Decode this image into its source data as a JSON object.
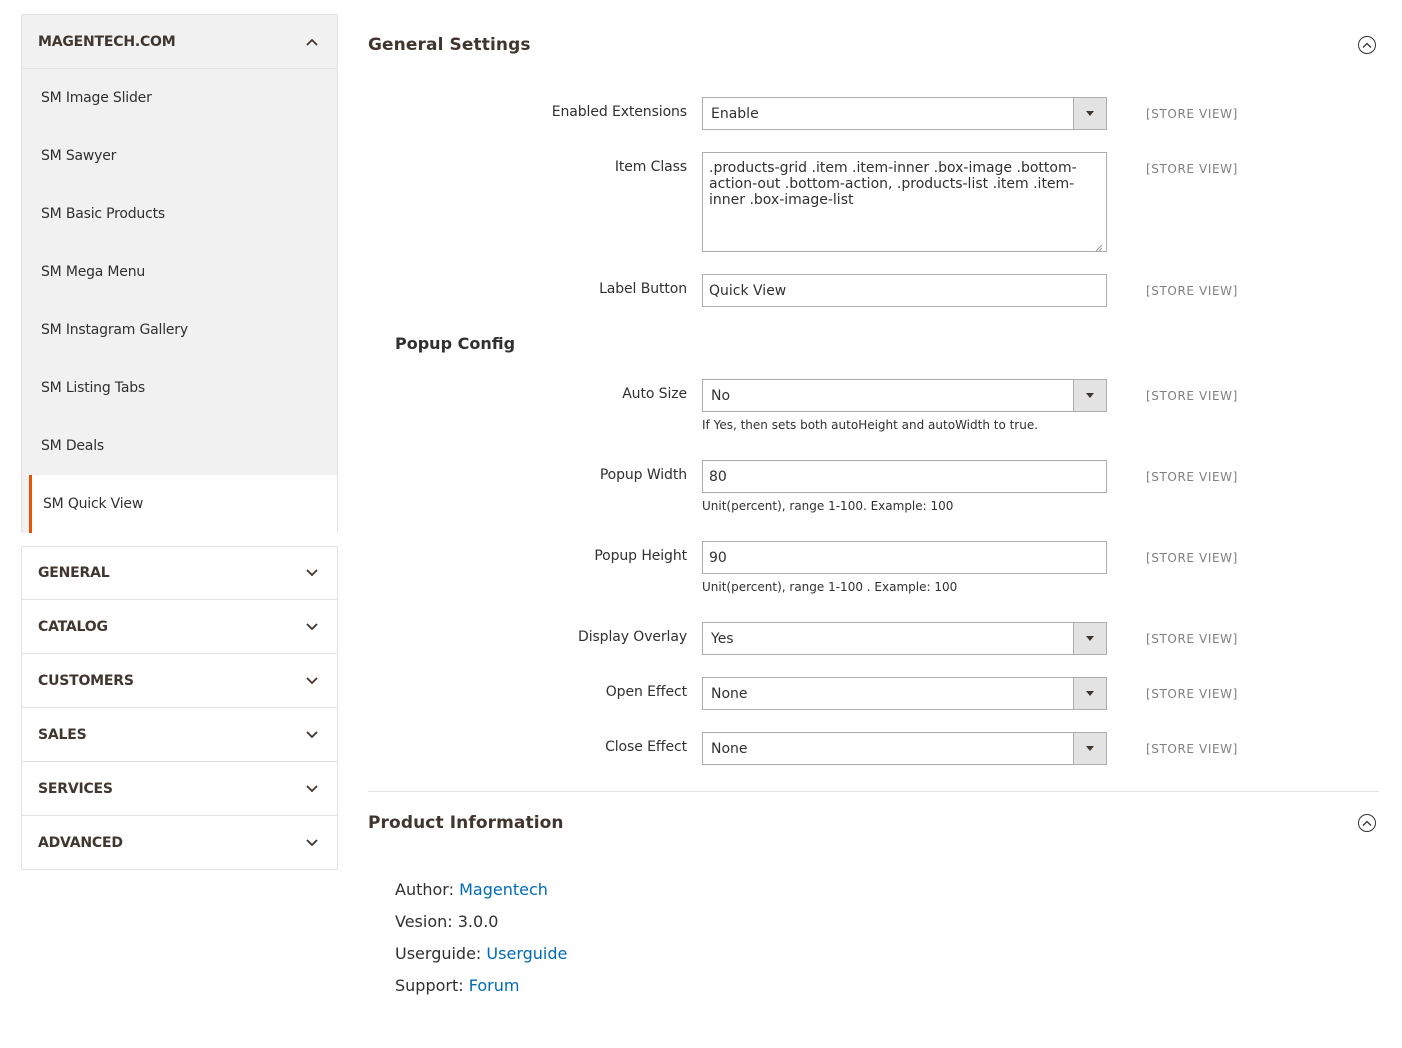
{
  "sidebar": {
    "group_title": "MAGENTECH.COM",
    "items": [
      {
        "label": "SM Image Slider"
      },
      {
        "label": "SM Sawyer"
      },
      {
        "label": "SM Basic Products"
      },
      {
        "label": "SM Mega Menu"
      },
      {
        "label": "SM Instagram Gallery"
      },
      {
        "label": "SM Listing Tabs"
      },
      {
        "label": "SM Deals"
      },
      {
        "label": "SM Quick View"
      }
    ],
    "active_item": "SM Quick View",
    "sections": [
      "GENERAL",
      "CATALOG",
      "CUSTOMERS",
      "SALES",
      "SERVICES",
      "ADVANCED"
    ]
  },
  "general": {
    "title": "General Settings",
    "fields": {
      "enabled": {
        "label": "Enabled Extensions",
        "value": "Enable",
        "scope": "[STORE VIEW]"
      },
      "item_class": {
        "label": "Item Class",
        "value": ".products-grid .item .item-inner .box-image .bottom-action-out .bottom-action, .products-list .item .item-inner .box-image-list",
        "scope": "[STORE VIEW]"
      },
      "label_button": {
        "label": "Label Button",
        "value": "Quick View",
        "scope": "[STORE VIEW]"
      }
    },
    "popup_title": "Popup Config",
    "popup": {
      "auto_size": {
        "label": "Auto Size",
        "value": "No",
        "scope": "[STORE VIEW]",
        "note": "If Yes, then sets both autoHeight and autoWidth to true."
      },
      "width": {
        "label": "Popup Width",
        "value": "80",
        "scope": "[STORE VIEW]",
        "note": "Unit(percent), range 1-100. Example: 100"
      },
      "height": {
        "label": "Popup Height",
        "value": "90",
        "scope": "[STORE VIEW]",
        "note": "Unit(percent), range 1-100 . Example: 100"
      },
      "overlay": {
        "label": "Display Overlay",
        "value": "Yes",
        "scope": "[STORE VIEW]"
      },
      "open_effect": {
        "label": "Open Effect",
        "value": "None",
        "scope": "[STORE VIEW]"
      },
      "close_effect": {
        "label": "Close Effect",
        "value": "None",
        "scope": "[STORE VIEW]"
      }
    }
  },
  "product_info": {
    "title": "Product Information",
    "author_label": "Author:",
    "author_value": "Magentech",
    "version_label": "Vesion:",
    "version_value": "3.0.0",
    "userguide_label": "Userguide:",
    "userguide_value": "Userguide",
    "support_label": "Support:",
    "support_value": "Forum"
  },
  "colors": {
    "accent": "#eb5202",
    "link": "#006bb4",
    "sidebar_bg": "#f1f1f1"
  }
}
